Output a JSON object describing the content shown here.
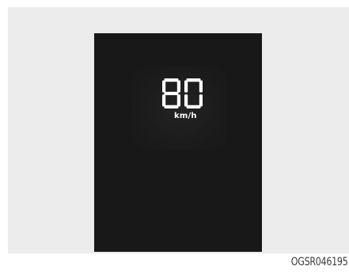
{
  "display": {
    "speed_value": "80",
    "speed_unit": "km/h",
    "background_color": "#181818",
    "digit_color": "#ffffff"
  },
  "figure": {
    "caption": "OGSR046195"
  }
}
